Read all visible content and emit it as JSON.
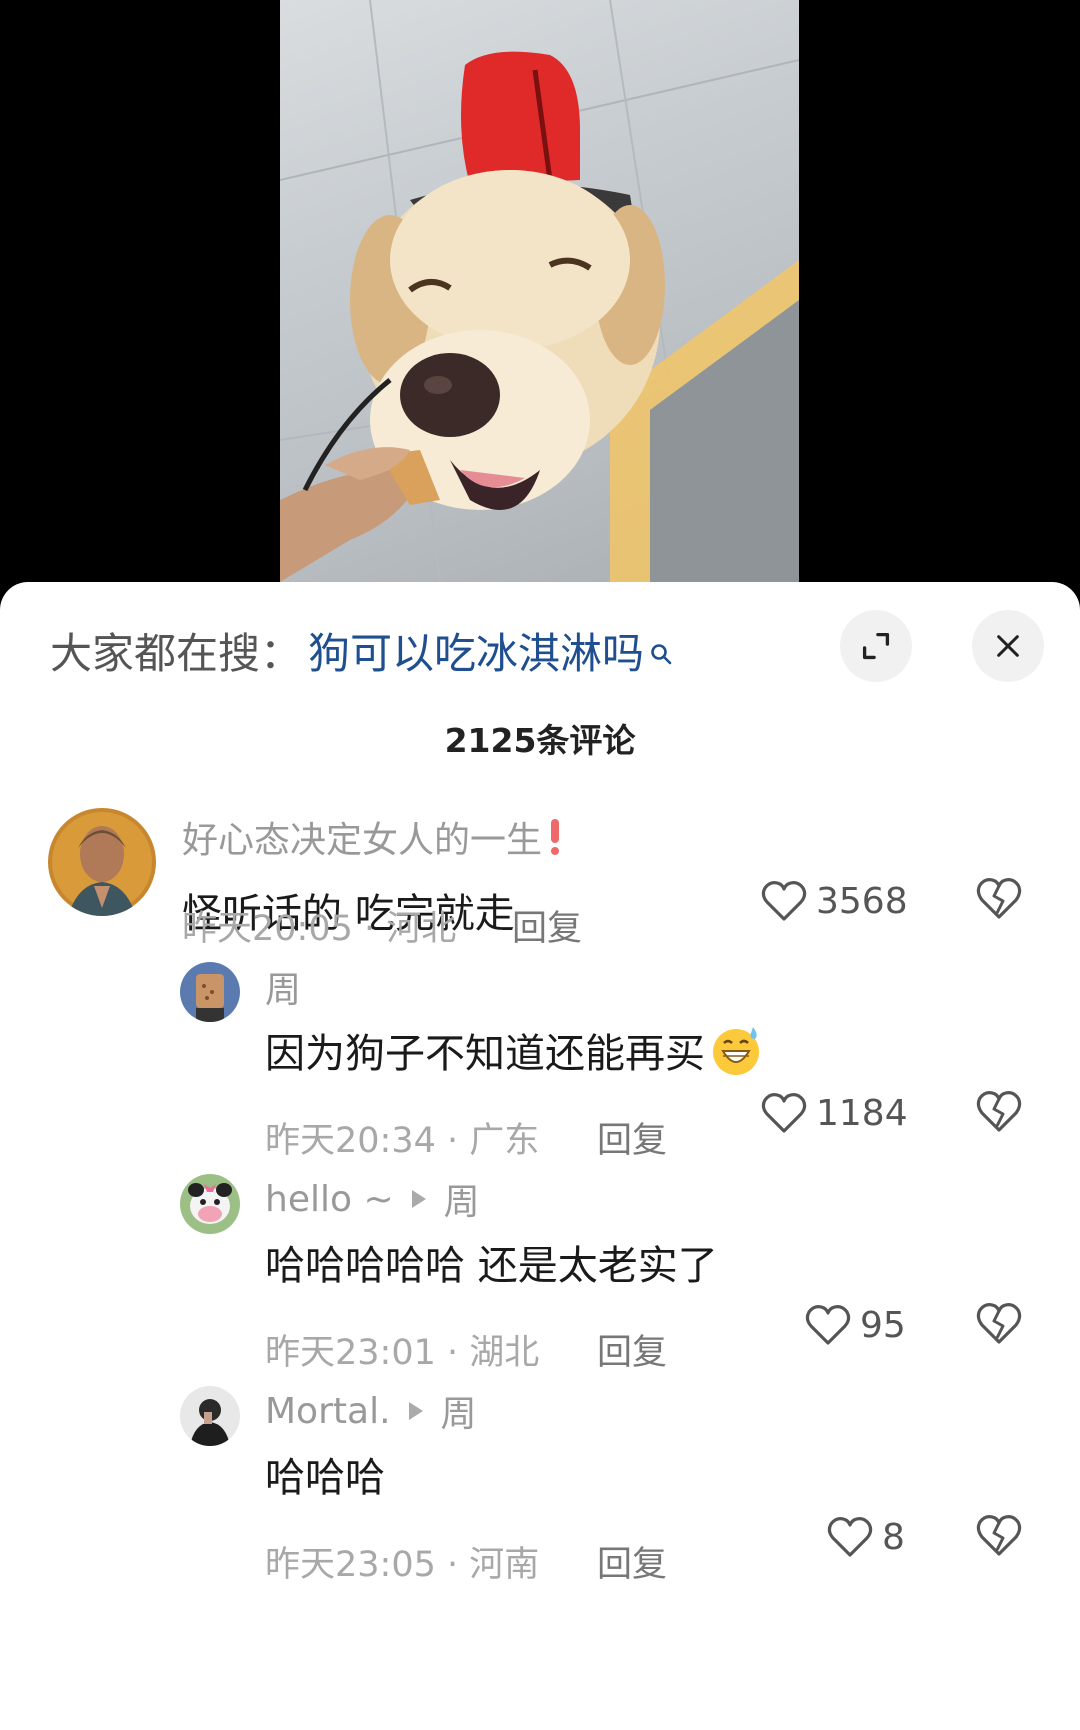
{
  "search": {
    "prefix": "大家都在搜：",
    "term": "狗可以吃冰淇淋吗"
  },
  "comment_count": "2125条评论",
  "comments": [
    {
      "username": "好心态决定女人的一生",
      "text": "怪听话的  吃完就走",
      "time": "昨天20:05 · 河北",
      "reply_label": "回复",
      "likes": "3568"
    },
    {
      "username": "周",
      "text": "因为狗子不知道还能再买",
      "emoji": "grinning-sweat-emoji",
      "time": "昨天20:34 · 广东",
      "reply_label": "回复",
      "likes": "1184"
    },
    {
      "username": "hello ~",
      "reply_to": "周",
      "text": "哈哈哈哈哈 还是太老实了",
      "time": "昨天23:01 · 湖北",
      "reply_label": "回复",
      "likes": "95"
    },
    {
      "username": "Mortal.",
      "reply_to": "周",
      "text": "哈哈哈",
      "time": "昨天23:05 · 河南",
      "reply_label": "回复",
      "likes": "8"
    }
  ],
  "colors": {
    "search_term": "#1f4f8f",
    "username": "#999999",
    "meta": "#a8a8a8",
    "dog_coat": "#e02a2a"
  }
}
